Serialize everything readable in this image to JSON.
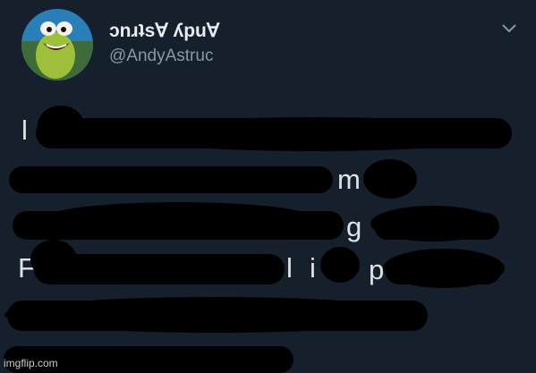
{
  "tweet": {
    "display_name": "ɔnɹʇs∀ ʎpu∀",
    "handle": "@AndyAstruc",
    "avatar_icon": "frog-cartoon-avatar",
    "menu_icon": "chevron-down-icon",
    "visible_letters": [
      "l",
      "m",
      "g",
      "F",
      "l",
      "i",
      "p"
    ],
    "body_redacted": true
  },
  "watermark": "imgflip.com",
  "colors": {
    "background": "#16202c",
    "text": "#e8ecef",
    "handle": "#8899a6",
    "redaction": "#000000"
  }
}
